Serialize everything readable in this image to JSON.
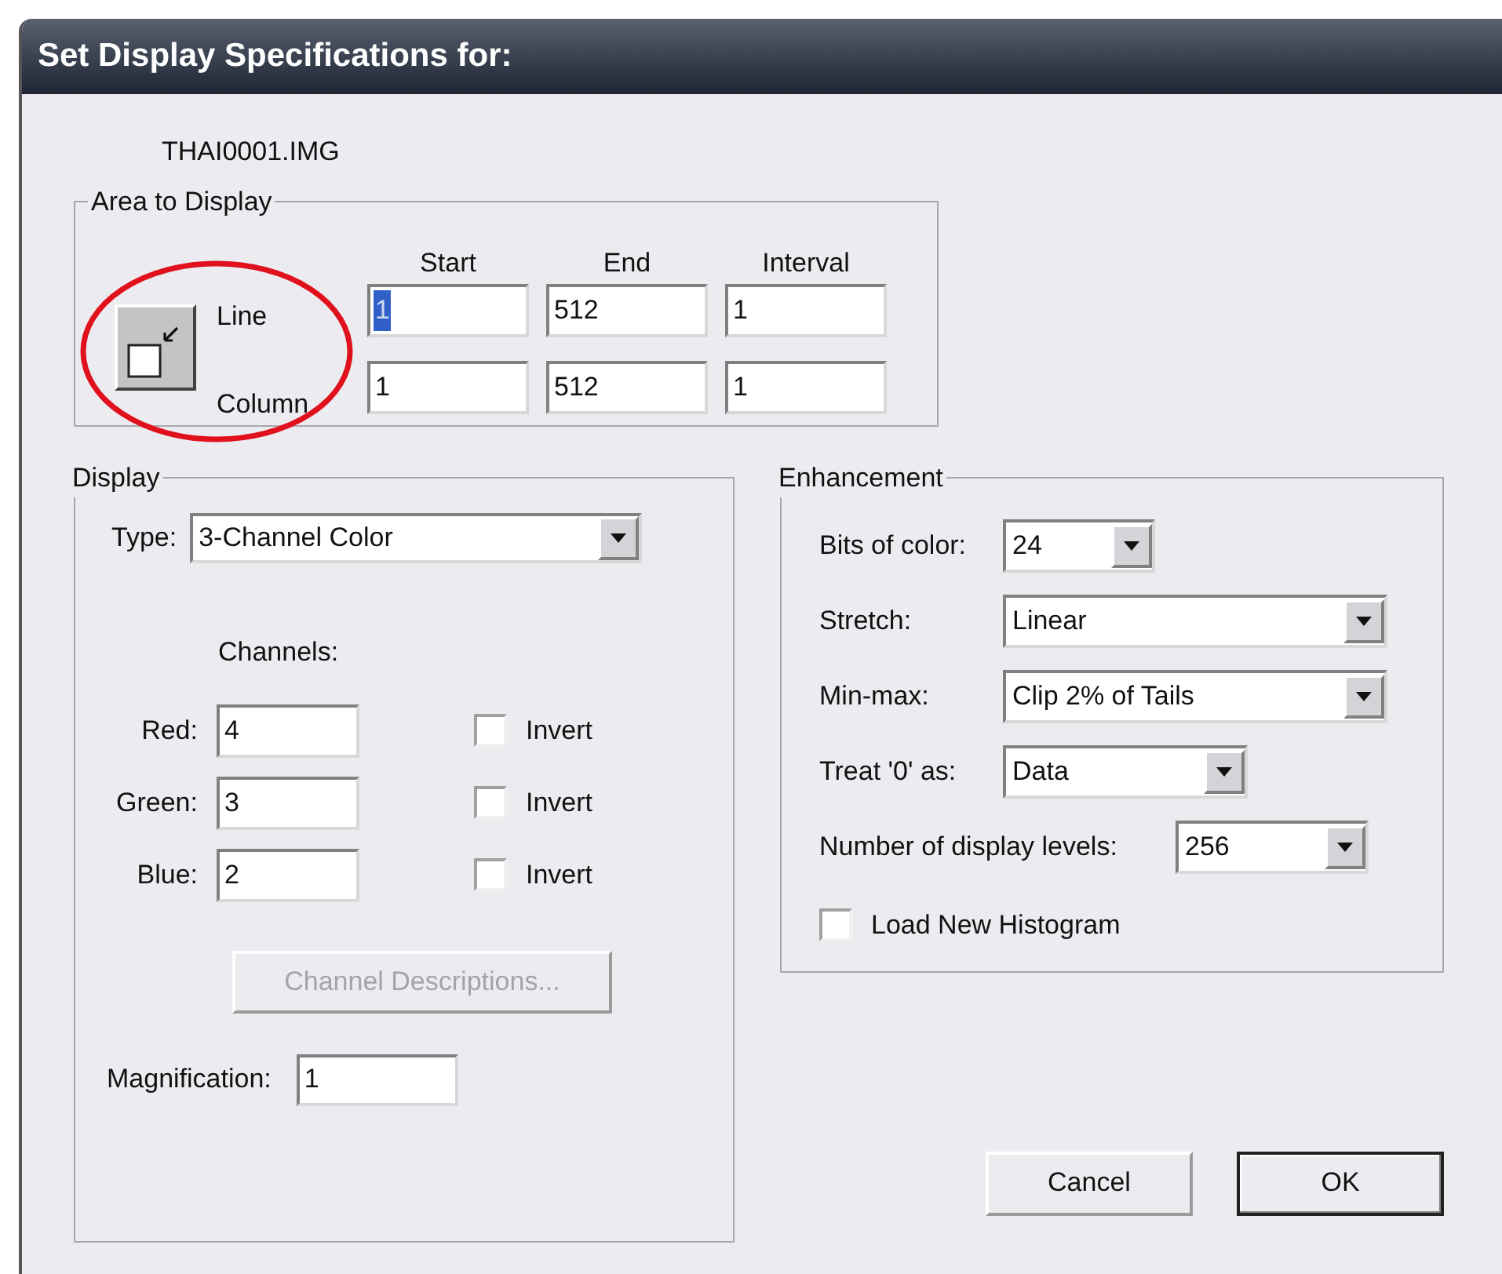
{
  "window": {
    "title": "Set Display Specifications for:"
  },
  "file_name": "THAI0001.IMG",
  "area": {
    "title": "Area to Display",
    "columns": [
      "Start",
      "End",
      "Interval"
    ],
    "rows": [
      {
        "label": "Line",
        "values": [
          {
            "value": "1",
            "selected": true
          },
          {
            "value": "512",
            "selected": false
          },
          {
            "value": "1",
            "selected": false
          }
        ]
      },
      {
        "label": "Column",
        "values": [
          {
            "value": "1",
            "selected": false
          },
          {
            "value": "512",
            "selected": false
          },
          {
            "value": "1",
            "selected": false
          }
        ]
      }
    ]
  },
  "display": {
    "title": "Display",
    "type": {
      "label": "Type:",
      "value": "3-Channel Color"
    },
    "channels_heading": "Channels:",
    "channels": [
      {
        "label": "Red:",
        "value": "4",
        "invert": {
          "label": "Invert",
          "checked": false
        }
      },
      {
        "label": "Green:",
        "value": "3",
        "invert": {
          "label": "Invert",
          "checked": false
        }
      },
      {
        "label": "Blue:",
        "value": "2",
        "invert": {
          "label": "Invert",
          "checked": false
        }
      }
    ],
    "descriptions_button": {
      "label": "Channel Descriptions...",
      "disabled": true
    },
    "magnification": {
      "label": "Magnification:",
      "value": "1"
    }
  },
  "enhancement": {
    "title": "Enhancement",
    "settings": [
      {
        "label": "Bits of color:",
        "value": "24"
      },
      {
        "label": "Stretch:",
        "value": "Linear"
      },
      {
        "label": "Min-max:",
        "value": "Clip 2% of Tails"
      },
      {
        "label": "Treat '0' as:",
        "value": "Data"
      },
      {
        "label": "Number of display levels:",
        "value": "256"
      }
    ],
    "load_histogram": {
      "label": "Load New Histogram",
      "checked": false
    }
  },
  "buttons": [
    {
      "label": "Cancel",
      "default": false
    },
    {
      "label": "OK",
      "default": true
    }
  ]
}
